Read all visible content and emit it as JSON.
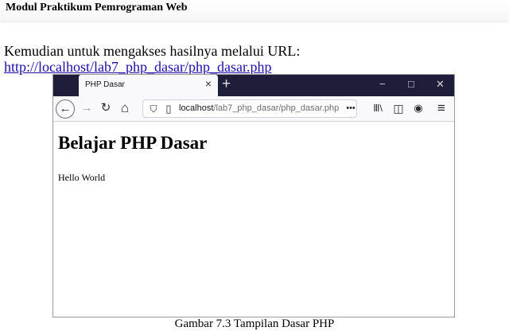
{
  "doc": {
    "header": "Modul Praktikum Pemrograman Web",
    "intro": "Kemudian untuk mengakses hasilnya melalui URL:",
    "link": "http://localhost/lab7_php_dasar/php_dasar.php",
    "caption": "Gambar 7.3 Tampilan Dasar PHP"
  },
  "browser": {
    "tab": {
      "title": "PHP Dasar",
      "close_icon": "×"
    },
    "new_tab_icon": "+",
    "window_controls": {
      "minimize": "−",
      "maximize": "□",
      "close": "✕"
    },
    "toolbar": {
      "back": "←",
      "forward": "→",
      "reload": "↻",
      "home": "⌂",
      "shield": "⛉",
      "page_icon": "▯",
      "url_host": "localhost",
      "url_path": "/lab7_php_dasar/php_dasar.php",
      "more_actions": "•••",
      "library": "Ⅲ\\",
      "sidebar": "◫",
      "account": "◉",
      "menu": "≡"
    },
    "page": {
      "heading": "Belajar PHP Dasar",
      "body_text": "Hello World"
    }
  }
}
